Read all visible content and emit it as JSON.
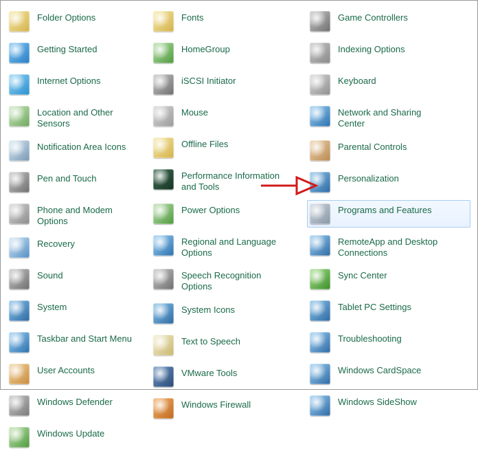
{
  "colors": {
    "link": "#1a6a49",
    "arrow": "#d11a1a",
    "highlight_border": "#a9cdee"
  },
  "arrow_target_index": 18,
  "columns": [
    [
      {
        "label": "Folder Options",
        "name": "folder-options",
        "c1": "#f6e9a9",
        "c2": "#d4b24b"
      },
      {
        "label": "Getting Started",
        "name": "getting-started",
        "c1": "#7fc6f0",
        "c2": "#2a7ec7"
      },
      {
        "label": "Internet Options",
        "name": "internet-options",
        "c1": "#8fd4f5",
        "c2": "#2b8fcf"
      },
      {
        "label": "Location and Other Sensors",
        "name": "location-sensors",
        "c1": "#cfe7c6",
        "c2": "#6da85a"
      },
      {
        "label": "Notification Area Icons",
        "name": "notification-area-icons",
        "c1": "#d7e8f5",
        "c2": "#7a99b3"
      },
      {
        "label": "Pen and Touch",
        "name": "pen-and-touch",
        "c1": "#c7c7c7",
        "c2": "#6f6f6f"
      },
      {
        "label": "Phone and Modem Options",
        "name": "phone-modem",
        "c1": "#d9d9d9",
        "c2": "#8a8a8a"
      },
      {
        "label": "Recovery",
        "name": "recovery",
        "c1": "#d7e8f5",
        "c2": "#528ec5"
      },
      {
        "label": "Sound",
        "name": "sound",
        "c1": "#c7c7c7",
        "c2": "#6f6f6f"
      },
      {
        "label": "System",
        "name": "system",
        "c1": "#89c4ea",
        "c2": "#2f6aa3"
      },
      {
        "label": "Taskbar and Start Menu",
        "name": "taskbar-start-menu",
        "c1": "#9dd1f5",
        "c2": "#2c71ad"
      },
      {
        "label": "User Accounts",
        "name": "user-accounts",
        "c1": "#f2d5a0",
        "c2": "#c98c3f"
      },
      {
        "label": "Windows Defender",
        "name": "windows-defender",
        "c1": "#c7c7c7",
        "c2": "#7a7a7a"
      },
      {
        "label": "Windows Update",
        "name": "windows-update",
        "c1": "#c0e2b0",
        "c2": "#4f9a3e"
      }
    ],
    [
      {
        "label": "Fonts",
        "name": "fonts",
        "c1": "#f6e9a9",
        "c2": "#d4b24b"
      },
      {
        "label": "HomeGroup",
        "name": "homegroup",
        "c1": "#b6e0a6",
        "c2": "#4f9a3e"
      },
      {
        "label": "iSCSI Initiator",
        "name": "iscsi-initiator",
        "c1": "#c7c7c7",
        "c2": "#6f6f6f"
      },
      {
        "label": "Mouse",
        "name": "mouse",
        "c1": "#d9d9d9",
        "c2": "#9a9a9a"
      },
      {
        "label": "Offline Files",
        "name": "offline-files",
        "c1": "#f6e9a9",
        "c2": "#d4b24b"
      },
      {
        "label": "Performance Information and Tools",
        "name": "performance-info",
        "c1": "#3f6f55",
        "c2": "#163322"
      },
      {
        "label": "Power Options",
        "name": "power-options",
        "c1": "#bfe0b1",
        "c2": "#4f9a3e"
      },
      {
        "label": "Regional and Language Options",
        "name": "regional-language",
        "c1": "#9dd1f5",
        "c2": "#2c71ad"
      },
      {
        "label": "Speech Recognition Options",
        "name": "speech-recognition",
        "c1": "#c7c7c7",
        "c2": "#6f6f6f"
      },
      {
        "label": "System Icons",
        "name": "system-icons",
        "c1": "#89c4ea",
        "c2": "#2f6aa3"
      },
      {
        "label": "Text to Speech",
        "name": "text-to-speech",
        "c1": "#f3eccf",
        "c2": "#c9b86f"
      },
      {
        "label": "VMware Tools",
        "name": "vmware-tools",
        "c1": "#6a92c2",
        "c2": "#2d4c77"
      },
      {
        "label": "Windows Firewall",
        "name": "windows-firewall",
        "c1": "#f2b16a",
        "c2": "#c06a1f"
      }
    ],
    [
      {
        "label": "Game Controllers",
        "name": "game-controllers",
        "c1": "#c7c7c7",
        "c2": "#6f6f6f"
      },
      {
        "label": "Indexing Options",
        "name": "indexing-options",
        "c1": "#c7c7c7",
        "c2": "#8a8a8a"
      },
      {
        "label": "Keyboard",
        "name": "keyboard",
        "c1": "#d9d9d9",
        "c2": "#8f8f8f"
      },
      {
        "label": "Network and Sharing Center",
        "name": "network-sharing",
        "c1": "#9dd1f5",
        "c2": "#2c71ad"
      },
      {
        "label": "Parental Controls",
        "name": "parental-controls",
        "c1": "#ecd2ad",
        "c2": "#ba8a52"
      },
      {
        "label": "Personalization",
        "name": "personalization",
        "c1": "#89c4ea",
        "c2": "#2f6aa3"
      },
      {
        "label": "Programs and Features",
        "name": "programs-features",
        "c1": "#cfd7df",
        "c2": "#8896a6",
        "highlight": true
      },
      {
        "label": "RemoteApp and Desktop Connections",
        "name": "remoteapp",
        "c1": "#9dd1f5",
        "c2": "#2f6aa3"
      },
      {
        "label": "Sync Center",
        "name": "sync-center",
        "c1": "#a7e08c",
        "c2": "#3b8f2a"
      },
      {
        "label": "Tablet PC Settings",
        "name": "tablet-pc",
        "c1": "#89c4ea",
        "c2": "#2f6aa3"
      },
      {
        "label": "Troubleshooting",
        "name": "troubleshooting",
        "c1": "#9dd1f5",
        "c2": "#2f6aa3"
      },
      {
        "label": "Windows CardSpace",
        "name": "windows-cardspace",
        "c1": "#9dd1f5",
        "c2": "#2f6aa3"
      },
      {
        "label": "Windows SideShow",
        "name": "windows-sideshow",
        "c1": "#9dd1f5",
        "c2": "#2f6aa3"
      }
    ]
  ]
}
